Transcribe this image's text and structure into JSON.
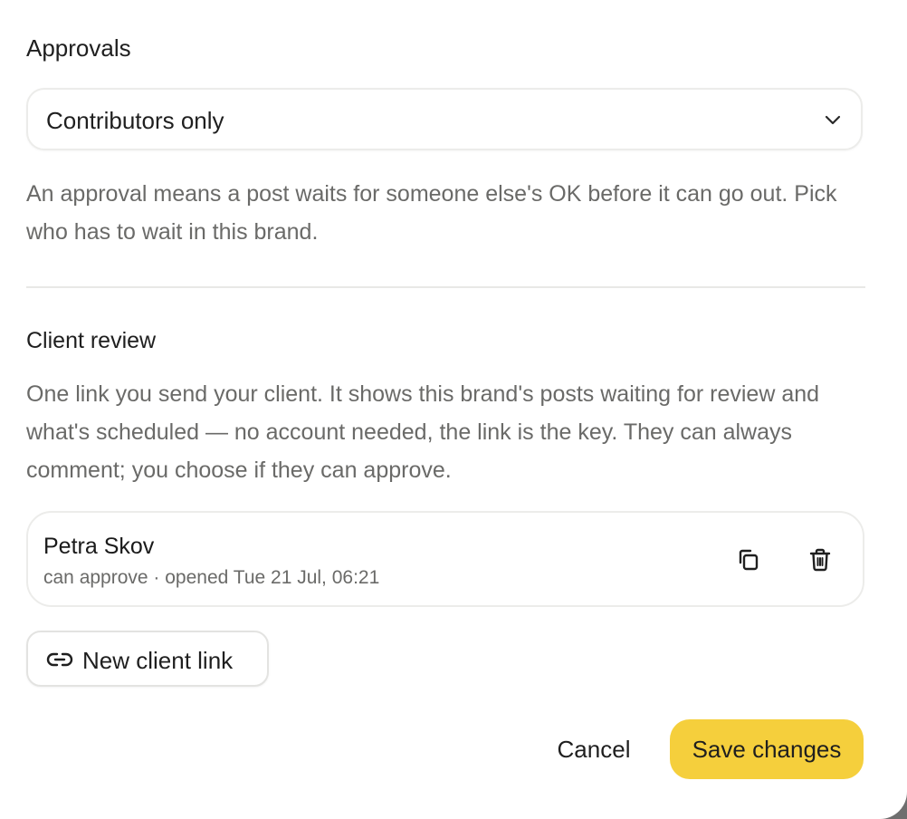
{
  "approvals": {
    "title": "Approvals",
    "selected_option": "Contributors only",
    "description": "An approval means a post waits for someone else's OK before it can go out. Pick who has to wait in this brand."
  },
  "client_review": {
    "title": "Client review",
    "description": "One link you send your client. It shows this brand's posts waiting for review and what's scheduled — no account needed, the link is the key. They can always comment; you choose if they can approve.",
    "links": [
      {
        "name": "Petra Skov",
        "meta": "can approve · opened Tue 21 Jul, 06:21"
      }
    ],
    "new_link_label": "New client link"
  },
  "footer": {
    "cancel_label": "Cancel",
    "save_label": "Save changes"
  },
  "icons": {
    "select": "chevron-down-icon",
    "copy": "copy-icon",
    "delete": "trash-icon",
    "new_link": "link-icon"
  },
  "colors": {
    "primary_button": "#f5cf3c",
    "muted_text": "#6a6a68",
    "border": "#ececea"
  }
}
